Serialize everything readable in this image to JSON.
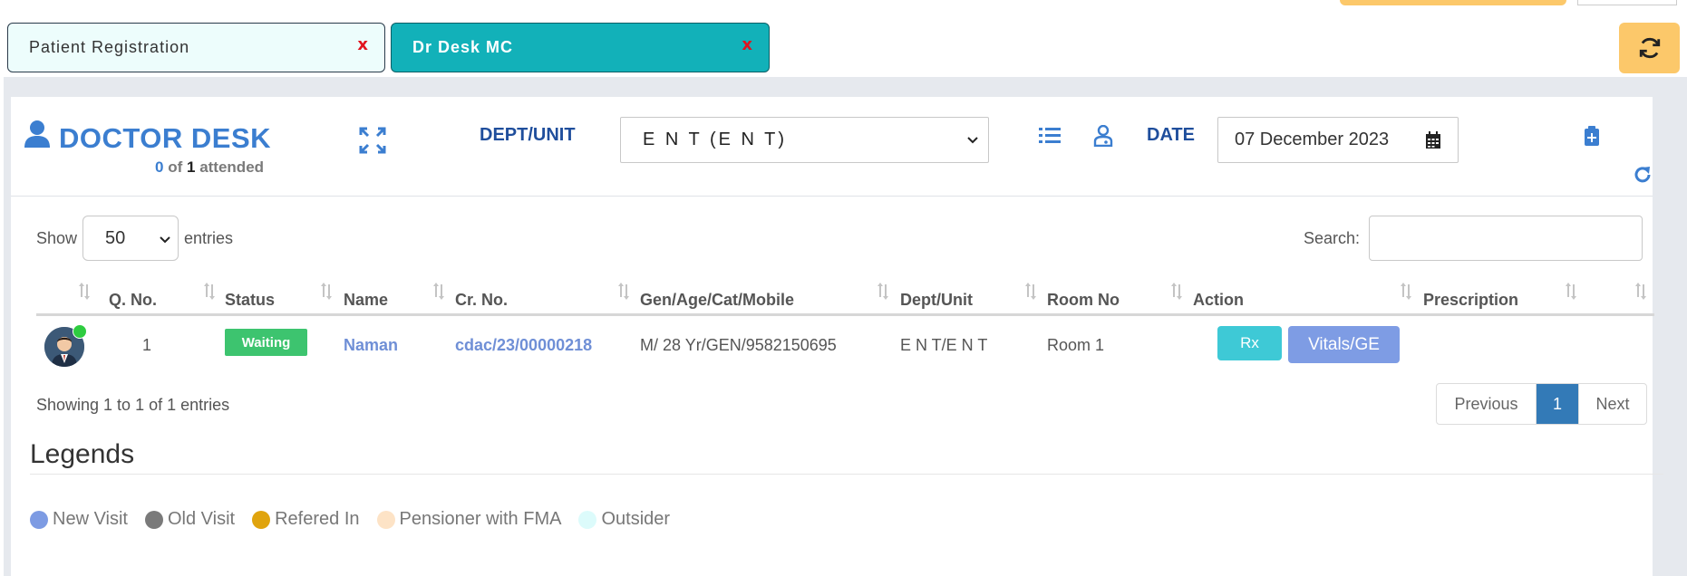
{
  "tabs": [
    {
      "label": "Patient Registration",
      "close": "x"
    },
    {
      "label": "Dr Desk MC",
      "close": "x"
    }
  ],
  "header": {
    "title": "DOCTOR DESK",
    "attended_count": "0",
    "attended_of": "of",
    "attended_total": "1",
    "attended_suffix": "attended",
    "dept_label": "DEPT/UNIT",
    "dept_value": "E N T (E N T)",
    "date_label": "DATE",
    "date_value": "07 December 2023"
  },
  "table_controls": {
    "show_label": "Show",
    "entries_value": "50",
    "entries_label": "entries",
    "search_label": "Search:",
    "search_value": ""
  },
  "columns": [
    "Q. No.",
    "Status",
    "Name",
    "Cr. No.",
    "Gen/Age/Cat/Mobile",
    "Dept/Unit",
    "Room No",
    "Action",
    "Prescription"
  ],
  "rows": [
    {
      "q_no": "1",
      "status": "Waiting",
      "name": "Naman",
      "cr_no": "cdac/23/00000218",
      "gen_age_cat_mobile": "M/ 28 Yr/GEN/9582150695",
      "dept_unit": "E N T/E N T",
      "room_no": "Room 1",
      "action_rx": "Rx",
      "action_vitals": "Vitals/GE",
      "prescription": ""
    }
  ],
  "footer": {
    "showing": "Showing 1 to 1 of 1 entries",
    "prev": "Previous",
    "page": "1",
    "next": "Next"
  },
  "legends": {
    "title": "Legends",
    "items": [
      {
        "label": "New Visit",
        "color": "#7d9be3"
      },
      {
        "label": "Old Visit",
        "color": "#7a7a7a"
      },
      {
        "label": "Refered In",
        "color": "#e0a40e"
      },
      {
        "label": "Pensioner with FMA",
        "color": "#fde3c6"
      },
      {
        "label": "Outsider",
        "color": "#dcfbfb"
      }
    ]
  },
  "colors": {
    "accent": "#3b7ed0",
    "active_tab": "#12b1b9",
    "refresh_button": "#fcc86a",
    "status_waiting": "#3dc46f"
  }
}
